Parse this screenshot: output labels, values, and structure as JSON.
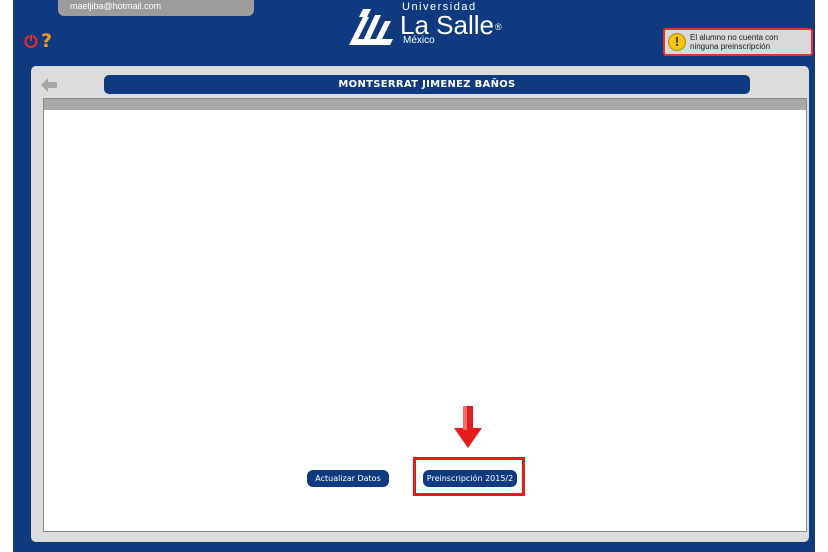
{
  "header": {
    "user_email": "maeljiba@hotmail.com",
    "logout_icon": "logout-icon",
    "help_icon": "?",
    "logo": {
      "top": "Universidad",
      "main": "La Salle",
      "reg": "®",
      "sub": "México"
    },
    "notice": {
      "icon": "!",
      "text": "El alumno no cuenta con ninguna preinscripción"
    }
  },
  "panel": {
    "back_icon": "back-arrow-icon",
    "student_name": "MONTSERRAT JIMENEZ BAÑOS"
  },
  "buttons": {
    "update_label": "Actualizar Datos",
    "preinscription_label": "Preinscripción 2015/2"
  },
  "colors": {
    "primary": "#0f3a80",
    "panel": "#dcdcdc",
    "highlight": "#e41c1c",
    "help": "#f29a1a"
  }
}
